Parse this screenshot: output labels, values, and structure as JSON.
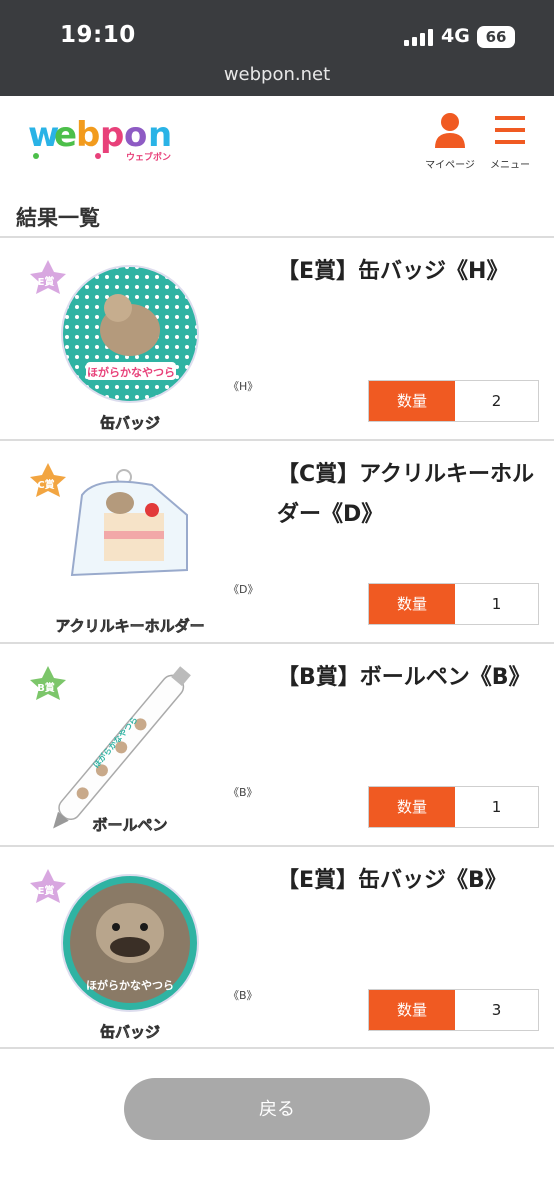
{
  "status_bar": {
    "time": "19:10",
    "network": "4G",
    "battery": "66",
    "url": "webpon.net"
  },
  "header": {
    "logo_text": "webpon",
    "logo_sub": "ウェブポン",
    "mypage_label": "マイページ",
    "menu_label": "メニュー",
    "accent_color": "#f05a22"
  },
  "section_title": "結果一覧",
  "quantity_label": "数量",
  "items": [
    {
      "badge": "E賞",
      "thumb_caption": "缶バッジ",
      "variant": "《H》",
      "title": "【E賞】缶バッジ《H》",
      "quantity": "2",
      "thumb_text": "ほがらかなやつら"
    },
    {
      "badge": "C賞",
      "thumb_caption": "アクリルキーホルダー",
      "variant": "《D》",
      "title": "【C賞】アクリルキーホルダー《D》",
      "quantity": "1",
      "thumb_text": ""
    },
    {
      "badge": "B賞",
      "thumb_caption": "ボールペン",
      "variant": "《B》",
      "title": "【B賞】ボールペン《B》",
      "quantity": "1",
      "thumb_text": "ほがらかなやつら"
    },
    {
      "badge": "E賞",
      "thumb_caption": "缶バッジ",
      "variant": "《B》",
      "title": "【E賞】缶バッジ《B》",
      "quantity": "3",
      "thumb_text": "ほがらかなやつら"
    }
  ],
  "back_button": "戻る"
}
